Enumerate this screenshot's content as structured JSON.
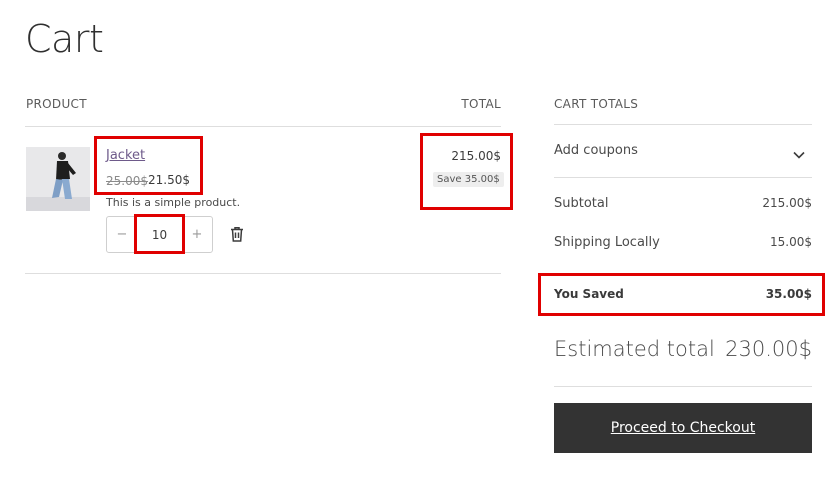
{
  "page": {
    "title": "Cart"
  },
  "table": {
    "product_header": "PRODUCT",
    "total_header": "TOTAL"
  },
  "item": {
    "name": "Jacket",
    "old_price": "25.00$",
    "new_price": "21.50$",
    "description": "This is a simple product.",
    "quantity": "10",
    "decrement_label": "−",
    "increment_label": "+",
    "line_total": "215.00$",
    "save_badge": "Save 35.00$",
    "image_icon": "product-photo",
    "remove_icon": "trash-icon"
  },
  "totals": {
    "header": "CART TOTALS",
    "coupons_label": "Add coupons",
    "subtotal_label": "Subtotal",
    "subtotal_value": "215.00$",
    "shipping_label": "Shipping Locally",
    "shipping_value": "15.00$",
    "saved_label": "You Saved",
    "saved_value": "35.00$",
    "estimated_label": "Estimated total",
    "estimated_value": "230.00$",
    "checkout_label": "Proceed to Checkout"
  },
  "colors": {
    "highlight": "#e00000",
    "checkout_bg": "#333333",
    "link": "#6e5a8a"
  }
}
